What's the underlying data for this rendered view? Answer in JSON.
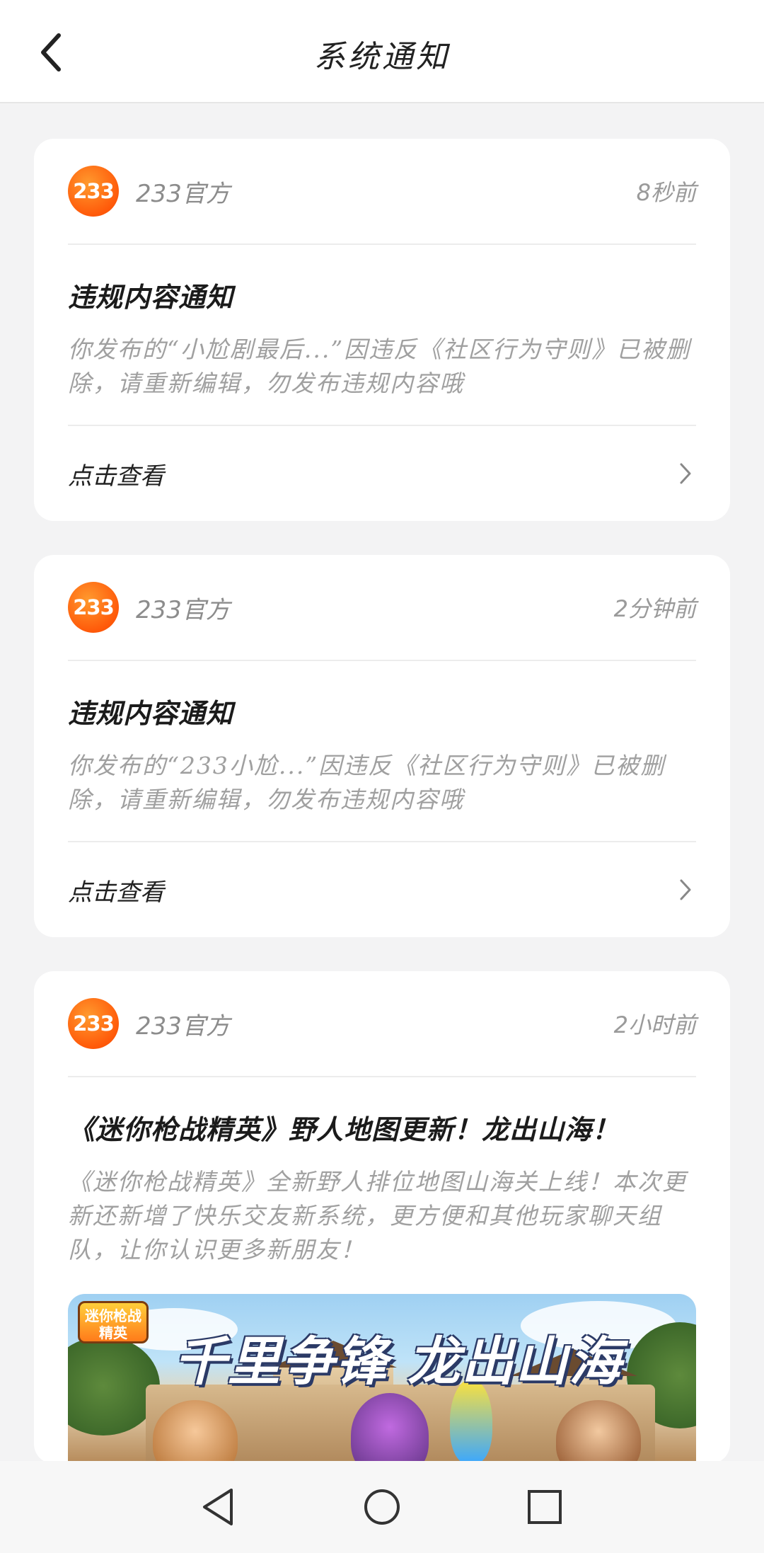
{
  "header": {
    "title": "系统通知",
    "back_icon": "chevron-left-icon"
  },
  "notifications": [
    {
      "sender": "233官方",
      "avatar_text": "233",
      "time": "8秒前",
      "title": "违规内容通知",
      "desc": "你发布的“小尬剧最后...”因违反《社区行为守则》已被删除，请重新编辑，勿发布违规内容哦",
      "action": "点击查看"
    },
    {
      "sender": "233官方",
      "avatar_text": "233",
      "time": "2分钟前",
      "title": "违规内容通知",
      "desc": "你发布的“233小尬...”因违反《社区行为守则》已被删除，请重新编辑，勿发布违规内容哦",
      "action": "点击查看"
    },
    {
      "sender": "233官方",
      "avatar_text": "233",
      "time": "2小时前",
      "title": "《迷你枪战精英》野人地图更新！龙出山海！",
      "desc": "《迷你枪战精英》全新野人排位地图山海关上线！本次更新还新增了快乐交友新系统，更方便和其他玩家聊天组队，让你认识更多新朋友！",
      "banner": {
        "slogan_left": "千里争锋",
        "slogan_right": "龙出山海",
        "logo_text": "迷你枪战精英"
      }
    }
  ],
  "system_nav": {
    "back": "triangle-back-icon",
    "home": "circle-home-icon",
    "recents": "square-recents-icon"
  },
  "colors": {
    "brand_orange": "#ff5a0a",
    "background": "#f3f3f4",
    "card": "#ffffff"
  }
}
